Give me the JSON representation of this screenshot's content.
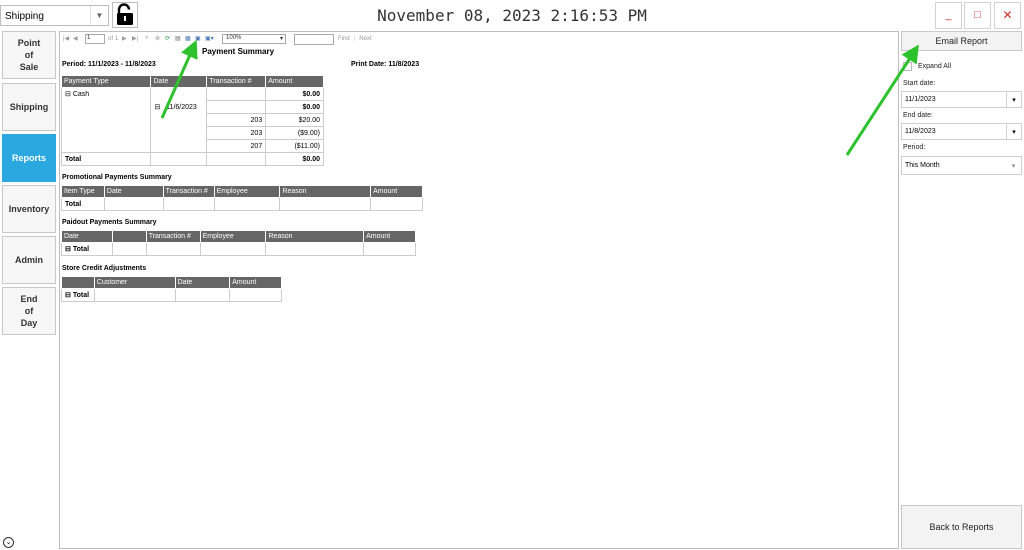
{
  "topbar": {
    "station_value": "Shipping",
    "clock": "November 08, 2023 2:16:53 PM"
  },
  "nav": [
    {
      "label": "Point\nof\nSale"
    },
    {
      "label": "Shipping"
    },
    {
      "label": "Reports"
    },
    {
      "label": "Inventory"
    },
    {
      "label": "Admin"
    },
    {
      "label": "End\nof\nDay"
    }
  ],
  "toolbar": {
    "page_value": "1",
    "page_of": "of",
    "page_total": "1",
    "zoom_value": "100%",
    "find_label": "Find",
    "next_label": "Next"
  },
  "report": {
    "title": "Payment Summary",
    "period": "Period: 11/1/2023 - 11/8/2023",
    "print_date": "Print Date: 11/8/2023",
    "payments": {
      "headers": [
        "Payment Type",
        "Date",
        "Transaction #",
        "Amount"
      ],
      "group_label": "Cash",
      "group_amount": "$0.00",
      "date_label": "11/6/2023",
      "date_amount": "$0.00",
      "rows": [
        {
          "txn": "203",
          "amount": "$20.00"
        },
        {
          "txn": "203",
          "amount": "($9.00)"
        },
        {
          "txn": "207",
          "amount": "($11.00)"
        }
      ],
      "total_label": "Total",
      "total_amount": "$0.00"
    },
    "promo": {
      "title": "Promotional Payments Summary",
      "headers": [
        "Item Type",
        "Date",
        "Transaction #",
        "Employee",
        "Reason",
        "Amount"
      ],
      "total_label": "Total"
    },
    "paidout": {
      "title": "Paidout Payments Summary",
      "headers": [
        "Date",
        "",
        "Transaction #",
        "Employee",
        "Reason",
        "Amount"
      ],
      "total_label": "Total"
    },
    "storecredit": {
      "title": "Store Credit Adjustments",
      "headers": [
        "",
        "Customer",
        "Date",
        "Amount"
      ],
      "total_label": "Total"
    }
  },
  "right": {
    "email_label": "Email Report",
    "expand_all_label": "Expand All",
    "start_label": "Start date:",
    "start_value": "11/1/2023",
    "end_label": "End date:",
    "end_value": "11/8/2023",
    "period_label": "Period:",
    "period_value": "This Month",
    "back_label": "Back to Reports"
  },
  "colors": {
    "accent": "#2ba8df",
    "header_gray": "#666666",
    "close_red": "#d32f2f",
    "annotation_arrow": "#2dc12d"
  }
}
